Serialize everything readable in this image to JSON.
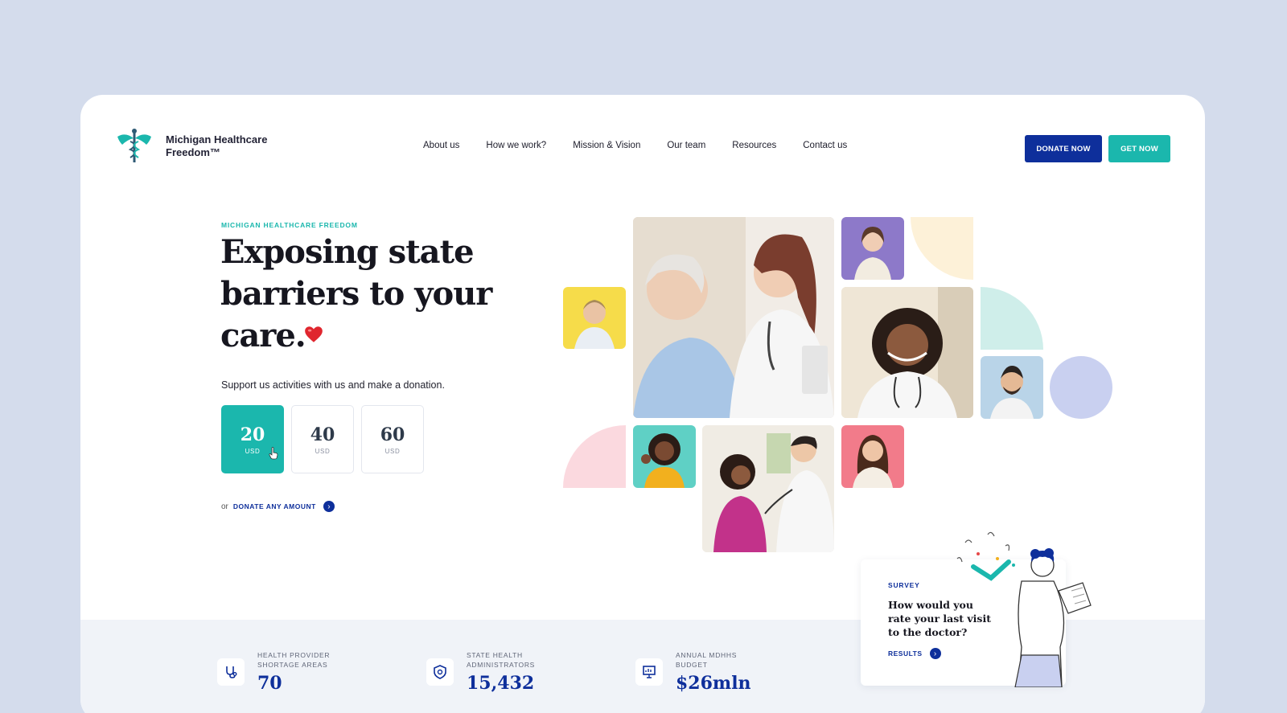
{
  "brand": {
    "name_line1": "Michigan Healthcare",
    "name_line2": "Freedom™",
    "logo_icon": "caduceus-icon",
    "accent_teal": "#1bb7ad",
    "accent_navy": "#0e2f9b"
  },
  "nav": {
    "items": [
      "About us",
      "How we work?",
      "Mission & Vision",
      "Our team",
      "Resources",
      "Contact us"
    ]
  },
  "header": {
    "donate_label": "DONATE NOW",
    "get_label": "GET NOW"
  },
  "hero": {
    "eyebrow": "MICHIGAN HEALTHCARE FREEDOM",
    "headline": "Exposing state barriers to your care.",
    "support_text": "Support us activities with us and make a donation.",
    "amounts": [
      {
        "value": "20",
        "currency": "USD",
        "selected": true
      },
      {
        "value": "40",
        "currency": "USD",
        "selected": false
      },
      {
        "value": "60",
        "currency": "USD",
        "selected": false
      }
    ],
    "or_text": "or",
    "donate_any_label": "DONATE ANY AMOUNT"
  },
  "stats": [
    {
      "label": "HEALTH PROVIDER SHORTAGE AREAS",
      "value": "70",
      "icon": "stethoscope-icon"
    },
    {
      "label": "STATE HEALTH ADMINISTRATORS",
      "value": "15,432",
      "icon": "shield-icon"
    },
    {
      "label": "ANNUAL MDHHS BUDGET",
      "value": "$26mln",
      "icon": "presentation-icon"
    }
  ],
  "survey": {
    "tag": "SURVEY",
    "question": "How would you rate your last visit to the doctor?",
    "results_label": "RESULTS"
  }
}
